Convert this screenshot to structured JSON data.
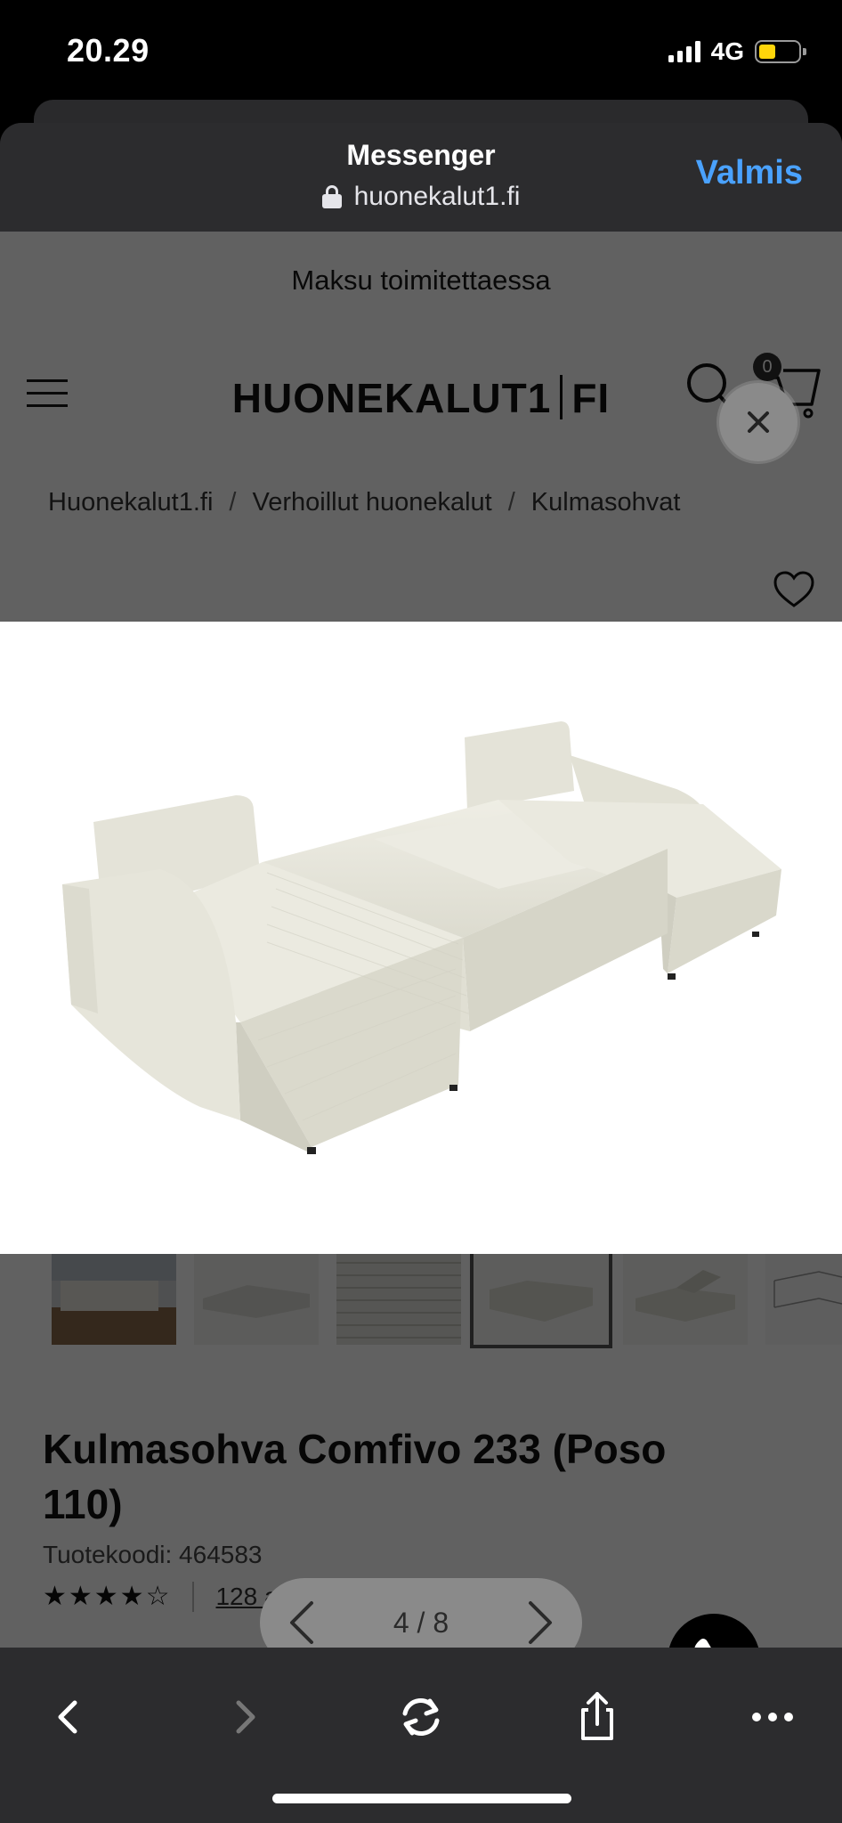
{
  "status": {
    "time": "20.29",
    "network": "4G",
    "battery_color": "#ffd60a"
  },
  "browser": {
    "title": "Messenger",
    "url": "huonekalut1.fi",
    "done_label": "Valmis",
    "accent": "#4aa2ff"
  },
  "site": {
    "promo": "Maksu toimitettaessa",
    "logo_left": "HUONEKALUT1",
    "logo_right": "FI",
    "cart_count": "0",
    "breadcrumbs": [
      "Huonekalut1.fi",
      "Verhoillut huonekalut",
      "Kulmasohvat"
    ],
    "breadcrumb_separator": "/"
  },
  "product": {
    "title": "Kulmasohva Comfivo 233 (Poso 110)",
    "code": "Tuotekoodi: 464583",
    "stars": "★★★★☆",
    "reviews": "128 arvostelua"
  },
  "viewer": {
    "counter": "4 / 8"
  },
  "icons": [
    "close-icon",
    "hamburger-icon",
    "search-icon",
    "cart-icon",
    "heart-icon",
    "phone-icon",
    "back-icon",
    "forward-icon",
    "reload-icon",
    "share-icon",
    "more-icon"
  ]
}
